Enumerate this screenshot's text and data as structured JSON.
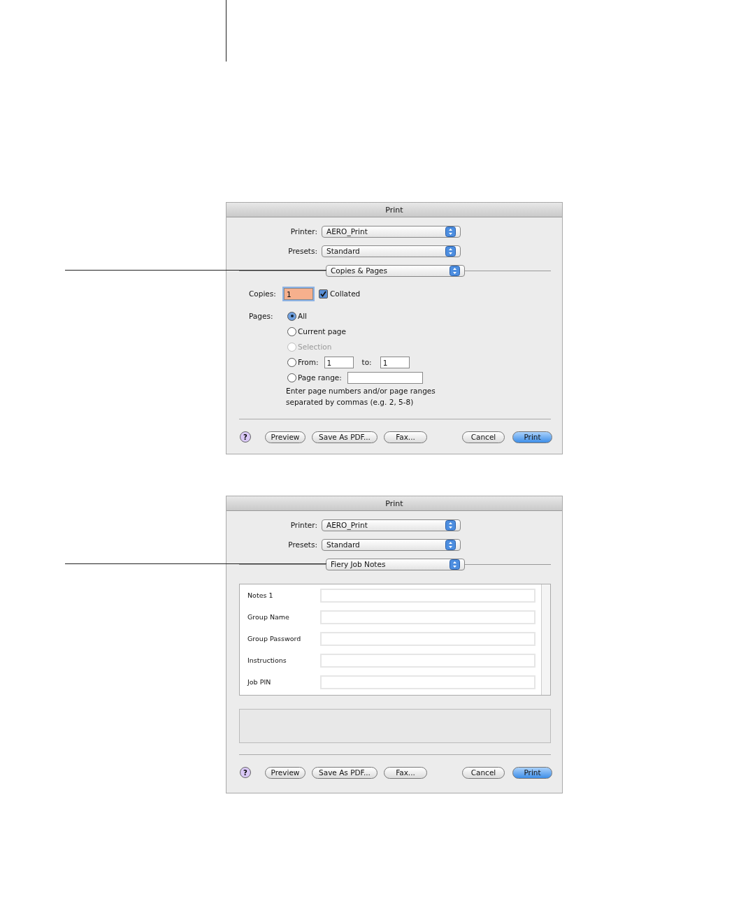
{
  "dialogs": [
    {
      "kind": "copies",
      "title": "Print",
      "popups": [
        {
          "label": "Printer:",
          "value": "AERO_Print"
        },
        {
          "label": "Presets:",
          "value": "Standard"
        }
      ],
      "panel": "Copies & Pages",
      "copies": {
        "label": "Copies:",
        "value": "1",
        "focused": true,
        "collated": {
          "label": "Collated",
          "checked": true
        }
      },
      "pages": {
        "label": "Pages:",
        "options": [
          {
            "kind": "plain",
            "label": "All",
            "selected": true,
            "disabled": false
          },
          {
            "kind": "plain",
            "label": "Current page",
            "selected": false,
            "disabled": false
          },
          {
            "kind": "plain",
            "label": "Selection",
            "selected": false,
            "disabled": true
          },
          {
            "kind": "from",
            "label": "From:",
            "value": "1",
            "to_label": "to:",
            "to_value": "1",
            "selected": false,
            "disabled": false
          },
          {
            "kind": "range",
            "label": "Page range:",
            "selected": false,
            "disabled": false
          }
        ],
        "hint": [
          "Enter page numbers and/or page ranges",
          "separated by commas (e.g. 2, 5-8)"
        ]
      },
      "help": "?",
      "buttons": [
        {
          "label": "Preview",
          "default": false
        },
        {
          "label": "Save As PDF...",
          "default": false
        },
        {
          "label": "Fax...",
          "default": false
        },
        {
          "label": "Cancel",
          "default": false
        },
        {
          "label": "Print",
          "default": true
        }
      ]
    },
    {
      "kind": "job_notes",
      "title": "Print",
      "popups": [
        {
          "label": "Printer:",
          "value": "AERO_Print"
        },
        {
          "label": "Presets:",
          "value": "Standard"
        }
      ],
      "panel": "Fiery Job Notes",
      "fields": [
        {
          "label": "Notes 1"
        },
        {
          "label": "Group Name"
        },
        {
          "label": "Group Password"
        },
        {
          "label": "Instructions"
        },
        {
          "label": "Job PIN"
        }
      ],
      "help": "?",
      "buttons": [
        {
          "label": "Preview",
          "default": false
        },
        {
          "label": "Save As PDF...",
          "default": false
        },
        {
          "label": "Fax...",
          "default": false
        },
        {
          "label": "Cancel",
          "default": false
        },
        {
          "label": "Print",
          "default": true
        }
      ]
    }
  ]
}
